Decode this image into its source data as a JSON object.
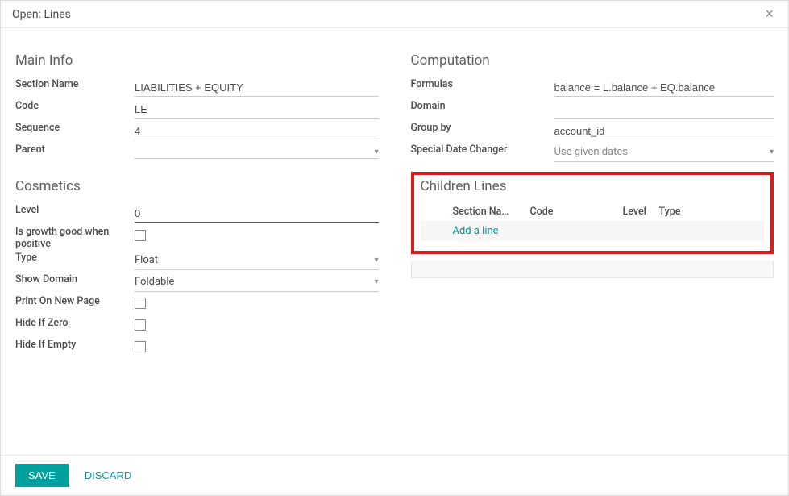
{
  "modal": {
    "title": "Open: Lines"
  },
  "main_info": {
    "heading": "Main Info",
    "section_name_label": "Section Name",
    "section_name_value": "LIABILITIES + EQUITY",
    "code_label": "Code",
    "code_value": "LE",
    "sequence_label": "Sequence",
    "sequence_value": "4",
    "parent_label": "Parent",
    "parent_value": ""
  },
  "cosmetics": {
    "heading": "Cosmetics",
    "level_label": "Level",
    "level_value": "0",
    "growth_label": "Is growth good when positive",
    "type_label": "Type",
    "type_value": "Float",
    "show_domain_label": "Show Domain",
    "show_domain_value": "Foldable",
    "print_new_page_label": "Print On New Page",
    "hide_if_zero_label": "Hide If Zero",
    "hide_if_empty_label": "Hide If Empty"
  },
  "computation": {
    "heading": "Computation",
    "formulas_label": "Formulas",
    "formulas_value": "balance = L.balance + EQ.balance",
    "domain_label": "Domain",
    "domain_value": "",
    "group_by_label": "Group by",
    "group_by_value": "account_id",
    "date_changer_label": "Special Date Changer",
    "date_changer_value": "Use given dates"
  },
  "children": {
    "heading": "Children Lines",
    "col_name": "Section Na…",
    "col_code": "Code",
    "col_level": "Level",
    "col_type": "Type",
    "add_line": "Add a line"
  },
  "footer": {
    "save": "SAVE",
    "discard": "DISCARD"
  }
}
